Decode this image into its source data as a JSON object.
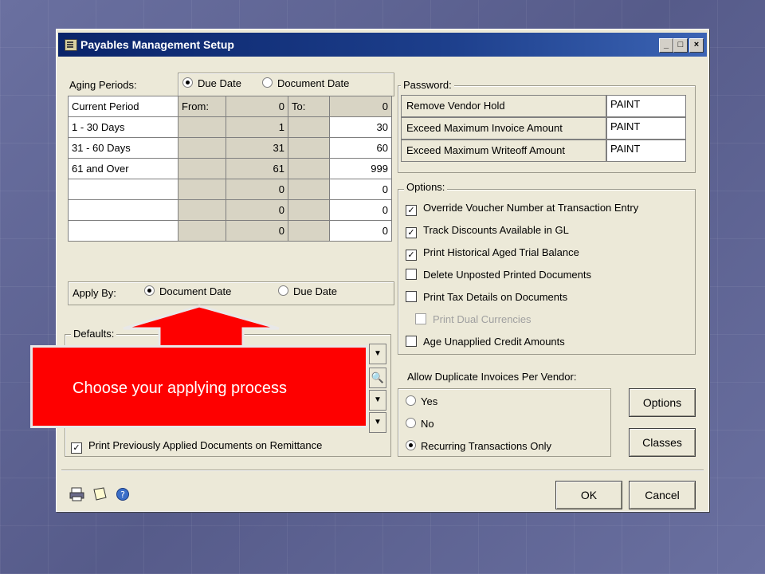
{
  "window": {
    "title": "Payables Management Setup"
  },
  "aging": {
    "label": "Aging Periods:",
    "radio_due_date": "Due Date",
    "radio_document_date": "Document Date",
    "col_from": "From:",
    "col_to": "To:",
    "rows": [
      {
        "name": "Current Period",
        "from": "0",
        "to": "0"
      },
      {
        "name": "1 - 30 Days",
        "from": "1",
        "to": "30"
      },
      {
        "name": "31 - 60 Days",
        "from": "31",
        "to": "60"
      },
      {
        "name": "61 and Over",
        "from": "61",
        "to": "999"
      },
      {
        "name": "",
        "from": "0",
        "to": "0"
      },
      {
        "name": "",
        "from": "0",
        "to": "0"
      },
      {
        "name": "",
        "from": "0",
        "to": "0"
      }
    ]
  },
  "apply_by": {
    "label": "Apply By:",
    "document_date": "Document Date",
    "due_date": "Due Date"
  },
  "defaults": {
    "label": "Defaults:",
    "print_previously": "Print Previously Applied Documents on Remittance"
  },
  "password": {
    "label": "Password:",
    "rows": [
      {
        "label": "Remove Vendor Hold",
        "value": "PAINT"
      },
      {
        "label": "Exceed Maximum Invoice Amount",
        "value": "PAINT"
      },
      {
        "label": "Exceed Maximum Writeoff Amount",
        "value": "PAINT"
      }
    ]
  },
  "options": {
    "label": "Options:",
    "items": [
      {
        "label": "Override Voucher Number at Transaction Entry",
        "checked": true
      },
      {
        "label": "Track Discounts  Available in GL",
        "checked": true
      },
      {
        "label": "Print Historical  Aged Trial Balance",
        "checked": true
      },
      {
        "label": "Delete Unposted Printed Documents",
        "checked": false
      },
      {
        "label": "Print Tax Details on Documents",
        "checked": false
      },
      {
        "label": "Print Dual Currencies",
        "checked": false,
        "disabled": true
      },
      {
        "label": "Age Unapplied Credit Amounts",
        "checked": false
      }
    ]
  },
  "duplicates": {
    "label": "Allow Duplicate Invoices Per Vendor:",
    "yes": "Yes",
    "no": "No",
    "recurring": "Recurring Transactions Only"
  },
  "buttons": {
    "options": "Options",
    "classes": "Classes",
    "ok": "OK",
    "cancel": "Cancel"
  },
  "callout": {
    "text": "Choose your applying process"
  },
  "icons": [
    "printer-icon",
    "note-icon",
    "help-icon"
  ]
}
